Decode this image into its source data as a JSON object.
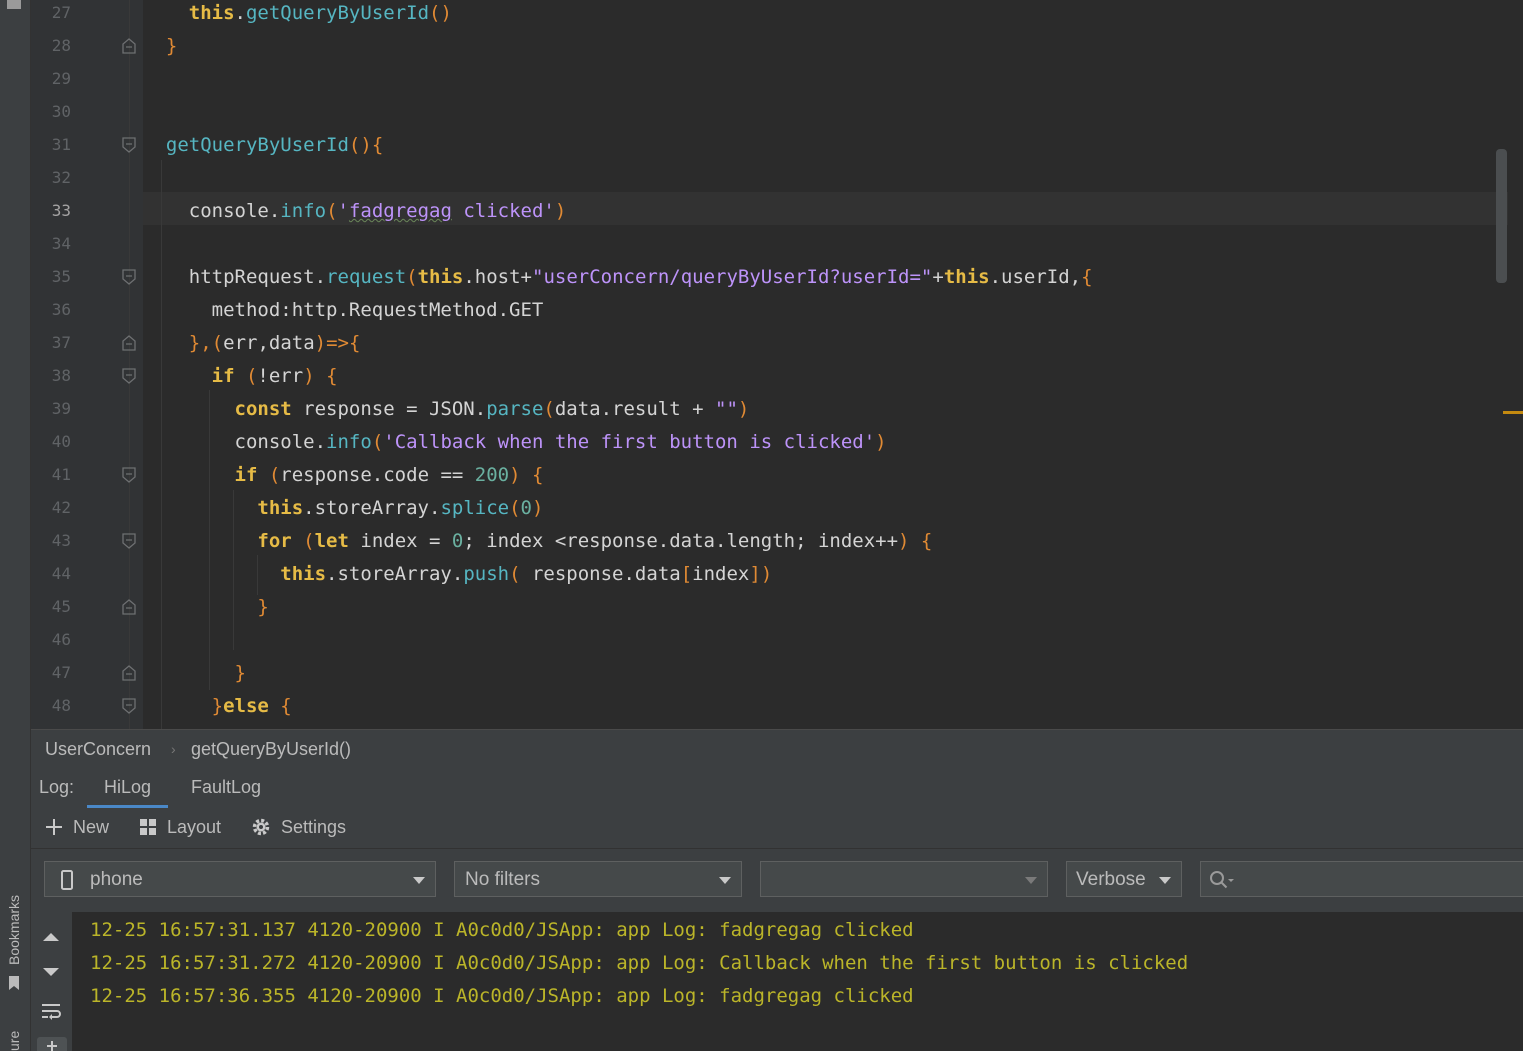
{
  "editor": {
    "current_line": 33,
    "lines": [
      {
        "n": "27",
        "fold": ""
      },
      {
        "n": "28",
        "fold": "end"
      },
      {
        "n": "29",
        "fold": ""
      },
      {
        "n": "30",
        "fold": ""
      },
      {
        "n": "31",
        "fold": "start"
      },
      {
        "n": "32",
        "fold": ""
      },
      {
        "n": "33",
        "fold": ""
      },
      {
        "n": "34",
        "fold": ""
      },
      {
        "n": "35",
        "fold": "start"
      },
      {
        "n": "36",
        "fold": ""
      },
      {
        "n": "37",
        "fold": "end"
      },
      {
        "n": "38",
        "fold": "start"
      },
      {
        "n": "39",
        "fold": ""
      },
      {
        "n": "40",
        "fold": ""
      },
      {
        "n": "41",
        "fold": "start"
      },
      {
        "n": "42",
        "fold": ""
      },
      {
        "n": "43",
        "fold": "start"
      },
      {
        "n": "44",
        "fold": ""
      },
      {
        "n": "45",
        "fold": "end"
      },
      {
        "n": "46",
        "fold": ""
      },
      {
        "n": "47",
        "fold": "end"
      },
      {
        "n": "48",
        "fold": "start"
      }
    ],
    "code": {
      "l27": {
        "this": "this",
        "dot": ".",
        "fn": "getQueryByUserId",
        "parens": "()"
      },
      "l28": {
        "brace": "}"
      },
      "l31": {
        "fn": "getQueryByUserId",
        "parens": "()",
        "brace": "{"
      },
      "l33": {
        "obj": "console",
        "dot": ".",
        "fn": "info",
        "open": "(",
        "q1": "'",
        "word": "fadgregag",
        "rest": " clicked'",
        "close": ")"
      },
      "l35": {
        "obj": "httpRequest",
        "dot": ".",
        "fn": "request",
        "open": "(",
        "this1": "this",
        "host": ".host+",
        "str": "\"userConcern/queryByUserId?userId=\"",
        "plus": "+",
        "this2": "this",
        "tail": ".userId,",
        "brace": "{"
      },
      "l36": {
        "text": "method:http.RequestMethod.GET"
      },
      "l37": {
        "b1": "}",
        "comma": ",",
        "open": "(",
        "args": "err,data",
        "close": ")",
        "arrow": "=>",
        "brace": "{"
      },
      "l38": {
        "kw": "if",
        "open": " (",
        "cond": "!err",
        "close": ")",
        "brace": " {"
      },
      "l39": {
        "kw": "const",
        "mid": " response = JSON.",
        "fn": "parse",
        "open": "(",
        "args": "data.result + ",
        "str": "\"\"",
        "close": ")"
      },
      "l40": {
        "obj": "console",
        "dot": ".",
        "fn": "info",
        "open": "(",
        "str": "'Callback when the first button is clicked'",
        "close": ")"
      },
      "l41": {
        "kw": "if",
        "open": " (",
        "cond": "response.code == ",
        "num": "200",
        "close": ")",
        "brace": " {"
      },
      "l42": {
        "this": "this",
        "mid": ".storeArray.",
        "fn": "splice",
        "open": "(",
        "num": "0",
        "close": ")"
      },
      "l43": {
        "kw": "for",
        "open": " (",
        "kw2": "let",
        "mid": " index = ",
        "num": "0",
        "rest": "; index <response.data.length; index++",
        "close": ")",
        "brace": " {"
      },
      "l44": {
        "this": "this",
        "mid": ".storeArray.",
        "fn": "push",
        "open": "(",
        "args": " response.data",
        "ob": "[",
        "idx": "index",
        "cb": "]",
        "close": ")"
      },
      "l45": {
        "brace": "}"
      },
      "l47": {
        "brace": "}"
      },
      "l48": {
        "brace": "}",
        "kw": "else",
        "brace2": " {"
      }
    }
  },
  "breadcrumb": {
    "items": [
      "UserConcern",
      "getQueryByUserId()"
    ],
    "separator": "›"
  },
  "log_panel": {
    "label": "Log:",
    "tabs": [
      "HiLog",
      "FaultLog"
    ],
    "active_tab": "HiLog",
    "toolbar": {
      "new_label": "New",
      "layout_label": "Layout",
      "settings_label": "Settings"
    },
    "filters": {
      "device": "phone",
      "filter": "No filters",
      "process": "",
      "level": "Verbose",
      "search_value": ""
    },
    "lines": [
      "12-25 16:57:31.137 4120-20900 I A0c0d0/JSApp: app Log: fadgregag clicked",
      "12-25 16:57:31.272 4120-20900 I A0c0d0/JSApp: app Log: Callback when the first button is clicked",
      "12-25 16:57:36.355 4120-20900 I A0c0d0/JSApp: app Log: fadgregag clicked"
    ]
  },
  "side_tabs": {
    "bookmarks": "Bookmarks",
    "structure": "ure"
  },
  "colors": {
    "keyword": "#e6bb46",
    "function": "#56b6c2",
    "string": "#bd93f9",
    "log_text": "#bbb529",
    "active_tab_underline": "#4a88c7"
  }
}
